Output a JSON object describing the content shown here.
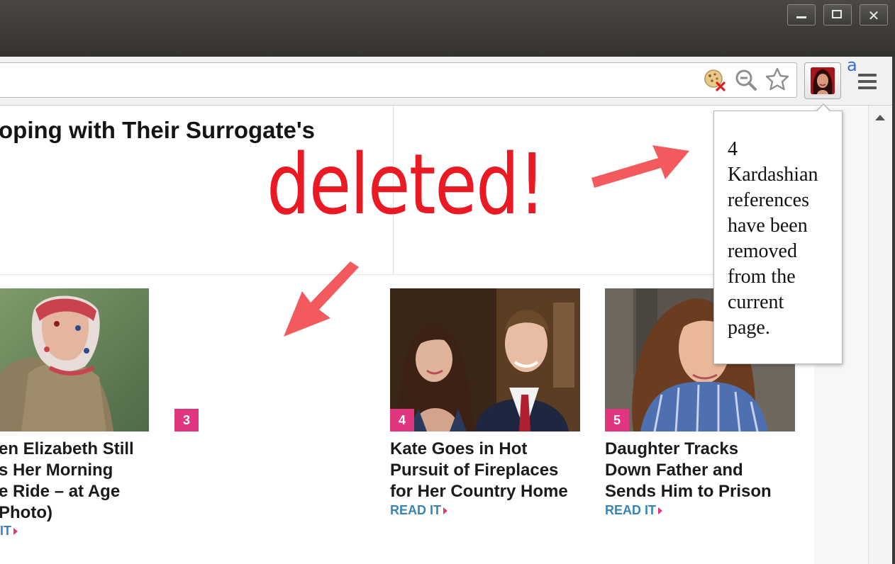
{
  "window": {
    "controls": [
      "minimize",
      "maximize",
      "close"
    ],
    "close_glyph": "✕"
  },
  "toolbar": {
    "icons": [
      "cookie-blocked-icon",
      "zoom-icon",
      "bookmark-star-icon",
      "extension-icon",
      "menu-icon"
    ],
    "extension_badge": "a"
  },
  "page": {
    "headline": "oping with Their Surrogate's",
    "annotation": "deleted!",
    "annotation_color": "#ea1a24",
    "accent_pink": "#e0357f",
    "link_blue": "#3a83b8",
    "articles": [
      {
        "number": "",
        "caption_lines": [
          "en Elizabeth Still",
          "s Her Morning",
          "e Ride – at Age",
          "Photo)"
        ],
        "read_label": "IT"
      },
      {
        "number": "3"
      },
      {
        "number": "4",
        "caption_lines": [
          "Kate Goes in Hot",
          "Pursuit of Fireplaces",
          "for Her Country Home"
        ],
        "read_label": "READ IT"
      },
      {
        "number": "5",
        "caption_lines": [
          "Daughter Tracks",
          "Down Father and",
          "Sends Him to Prison"
        ],
        "read_label": "READ IT"
      }
    ]
  },
  "popup": {
    "lines": [
      "4",
      "Kardashian",
      "references",
      "have been",
      "removed",
      "from the",
      "current",
      "page."
    ]
  }
}
